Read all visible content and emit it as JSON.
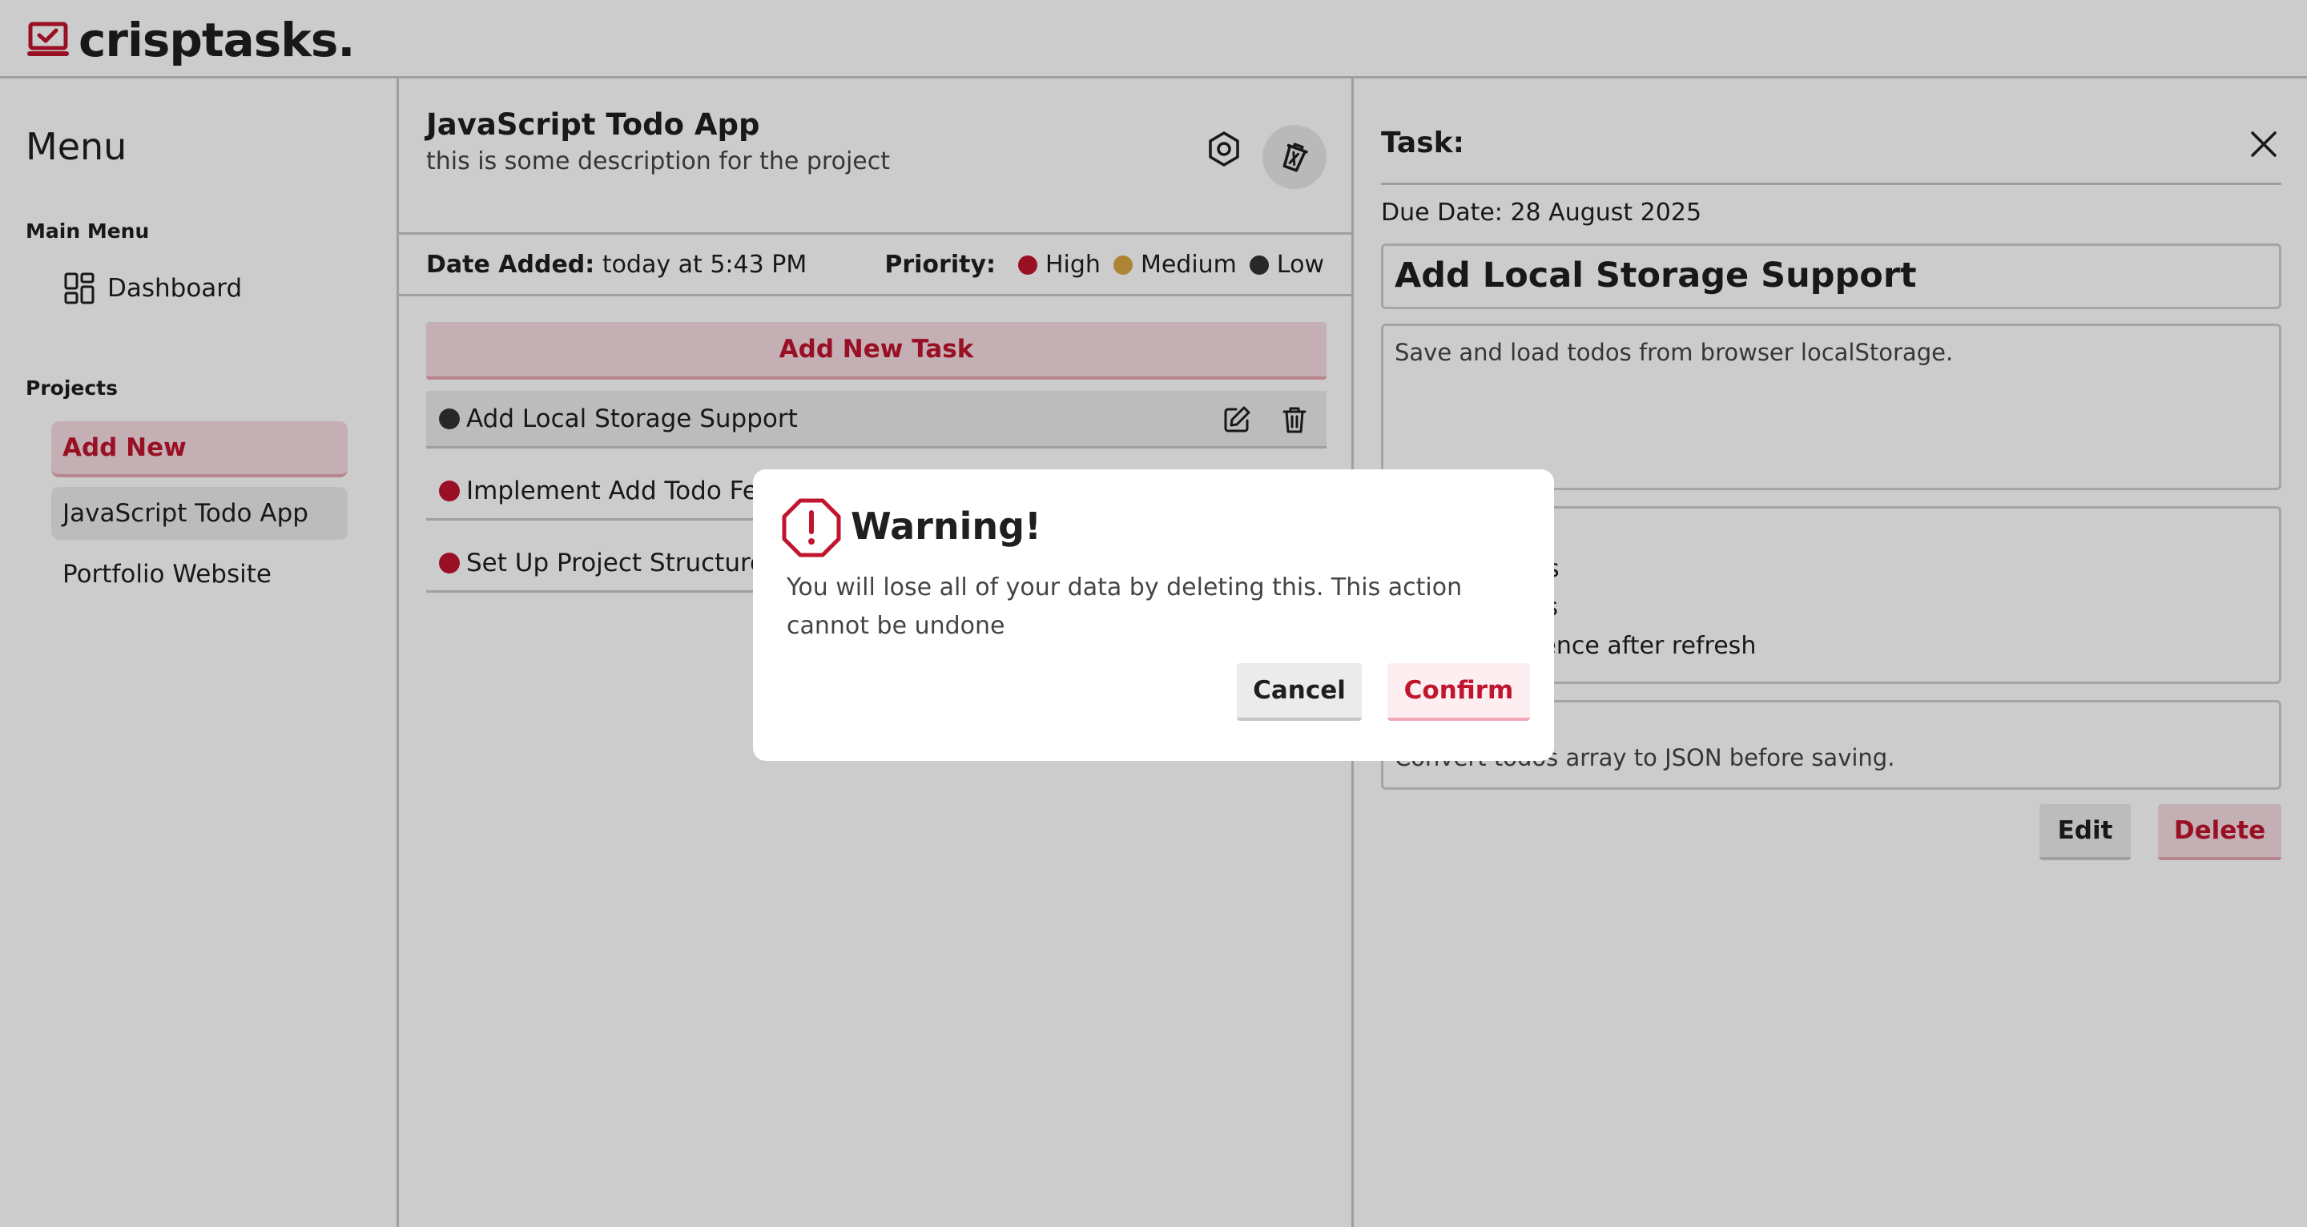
{
  "brand": {
    "name": "crisptasks.",
    "accent": "#c0152f"
  },
  "sidebar": {
    "title": "Menu",
    "main_menu_label": "Main Menu",
    "dashboard_label": "Dashboard",
    "projects_label": "Projects",
    "projects": [
      {
        "label": "Add New"
      },
      {
        "label": "JavaScript Todo App"
      },
      {
        "label": "Portfolio Website"
      }
    ]
  },
  "project": {
    "title": "JavaScript Todo App",
    "description": "this is some description for the project",
    "date_added_label": "Date Added:",
    "date_added_value": "today at 5:43 PM",
    "priority_label": "Priority:",
    "priorities": [
      {
        "label": "High",
        "color": "#c0152f"
      },
      {
        "label": "Medium",
        "color": "#d9a441"
      },
      {
        "label": "Low",
        "color": "#333333"
      }
    ],
    "add_task_label": "Add New Task",
    "tasks": [
      {
        "title": "Add Local Storage Support",
        "color": "#333333"
      },
      {
        "title": "Implement Add Todo Feature",
        "color": "#c0152f"
      },
      {
        "title": "Set Up Project Structure",
        "color": "#c0152f"
      }
    ]
  },
  "task_detail": {
    "label": "Task:",
    "due_date": "Due Date: 28 August 2025",
    "title": "Add Local Storage Support",
    "description": "Save and load todos from browser localStorage.",
    "checklist": [
      "s",
      "os",
      "stence after refresh"
    ],
    "notes": "Convert todos array to JSON before saving.",
    "edit_label": "Edit",
    "delete_label": "Delete"
  },
  "modal": {
    "title": "Warning!",
    "message": "You will lose all of your data by deleting this. This action cannot be undone",
    "cancel_label": "Cancel",
    "confirm_label": "Confirm"
  }
}
